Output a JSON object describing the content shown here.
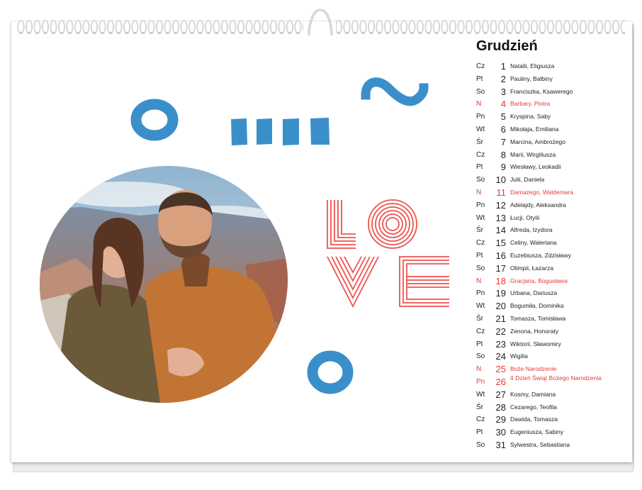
{
  "calendar": {
    "month": "Grudzień",
    "decor_word": [
      "LO",
      "VE"
    ],
    "colors": {
      "accent_blue": "#3a8fcb",
      "love_red": "#ef5350",
      "holiday_red": "#e53935"
    },
    "photo": {
      "description_icon": "couple-selfie-photo"
    },
    "days": [
      {
        "dow": "Cz",
        "num": "1",
        "names": "Natalii, Eligiusza",
        "holiday": false
      },
      {
        "dow": "Pt",
        "num": "2",
        "names": "Pauliny, Balbiny",
        "holiday": false
      },
      {
        "dow": "So",
        "num": "3",
        "names": "Franciszka, Ksawerego",
        "holiday": false
      },
      {
        "dow": "N",
        "num": "4",
        "names": "Barbary, Piotra",
        "holiday": true
      },
      {
        "dow": "Pn",
        "num": "5",
        "names": "Kryspina, Saby",
        "holiday": false
      },
      {
        "dow": "Wt",
        "num": "6",
        "names": "Mikołaja, Emiliana",
        "holiday": false
      },
      {
        "dow": "Śr",
        "num": "7",
        "names": "Marcina, Ambrożego",
        "holiday": false
      },
      {
        "dow": "Cz",
        "num": "8",
        "names": "Marii, Wirgiliusza",
        "holiday": false
      },
      {
        "dow": "Pt",
        "num": "9",
        "names": "Wiesławy, Leokadii",
        "holiday": false
      },
      {
        "dow": "So",
        "num": "10",
        "names": "Julii, Daniela",
        "holiday": false
      },
      {
        "dow": "N",
        "num": "11",
        "names": "Damazego, Waldemara",
        "holiday": true
      },
      {
        "dow": "Pn",
        "num": "12",
        "names": "Adelajdy, Aleksandra",
        "holiday": false
      },
      {
        "dow": "Wt",
        "num": "13",
        "names": "Łucji, Otylii",
        "holiday": false
      },
      {
        "dow": "Śr",
        "num": "14",
        "names": "Alfreda, Izydora",
        "holiday": false
      },
      {
        "dow": "Cz",
        "num": "15",
        "names": "Celiny, Waleriana",
        "holiday": false
      },
      {
        "dow": "Pt",
        "num": "16",
        "names": "Euzebiusza, Zdzisławy",
        "holiday": false
      },
      {
        "dow": "So",
        "num": "17",
        "names": "Olimpii, Łazarza",
        "holiday": false
      },
      {
        "dow": "N",
        "num": "18",
        "names": "Gracjana, Bogusława",
        "holiday": true
      },
      {
        "dow": "Pn",
        "num": "19",
        "names": "Urbana, Dariusza",
        "holiday": false
      },
      {
        "dow": "Wt",
        "num": "20",
        "names": "Bogumiła, Dominika",
        "holiday": false
      },
      {
        "dow": "Śr",
        "num": "21",
        "names": "Tomasza, Tomisława",
        "holiday": false
      },
      {
        "dow": "Cz",
        "num": "22",
        "names": "Zenona, Honoraty",
        "holiday": false
      },
      {
        "dow": "Pt",
        "num": "23",
        "names": "Wiktorii, Sławomiry",
        "holiday": false
      },
      {
        "dow": "So",
        "num": "24",
        "names": "Wigilia",
        "holiday": false
      },
      {
        "dow": "N",
        "num": "25",
        "names": "Boże Narodzenie",
        "holiday": true
      },
      {
        "dow": "Pn",
        "num": "26",
        "names": "II Dzień Świąt Bożego Narodzenia",
        "holiday": true
      },
      {
        "dow": "Wt",
        "num": "27",
        "names": "Kosmy, Damiana",
        "holiday": false
      },
      {
        "dow": "Śr",
        "num": "28",
        "names": "Cezarego, Teofila",
        "holiday": false
      },
      {
        "dow": "Cz",
        "num": "29",
        "names": "Dawida, Tomasza",
        "holiday": false
      },
      {
        "dow": "Pt",
        "num": "30",
        "names": "Eugeniusza, Sabiny",
        "holiday": false
      },
      {
        "dow": "So",
        "num": "31",
        "names": "Sylwestra, Sebastiana",
        "holiday": false
      }
    ]
  }
}
